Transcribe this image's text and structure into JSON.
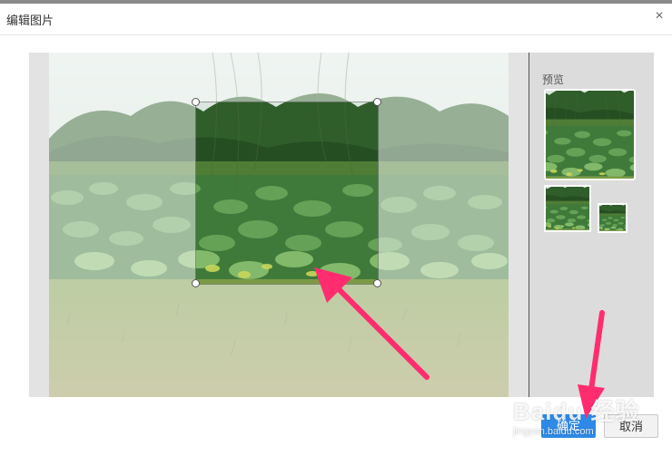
{
  "dialog": {
    "title": "编辑图片",
    "close_glyph": "×",
    "close_icon": "close-icon"
  },
  "preview": {
    "label": "预览"
  },
  "buttons": {
    "confirm": "确定",
    "cancel": "取消"
  },
  "colors": {
    "confirm_button": "#2e8ae6",
    "annotation_arrow": "#ff2d6f"
  },
  "watermark": {
    "logo_text": "Baidu 经验",
    "url_text": "jingyan.baidu.com"
  }
}
